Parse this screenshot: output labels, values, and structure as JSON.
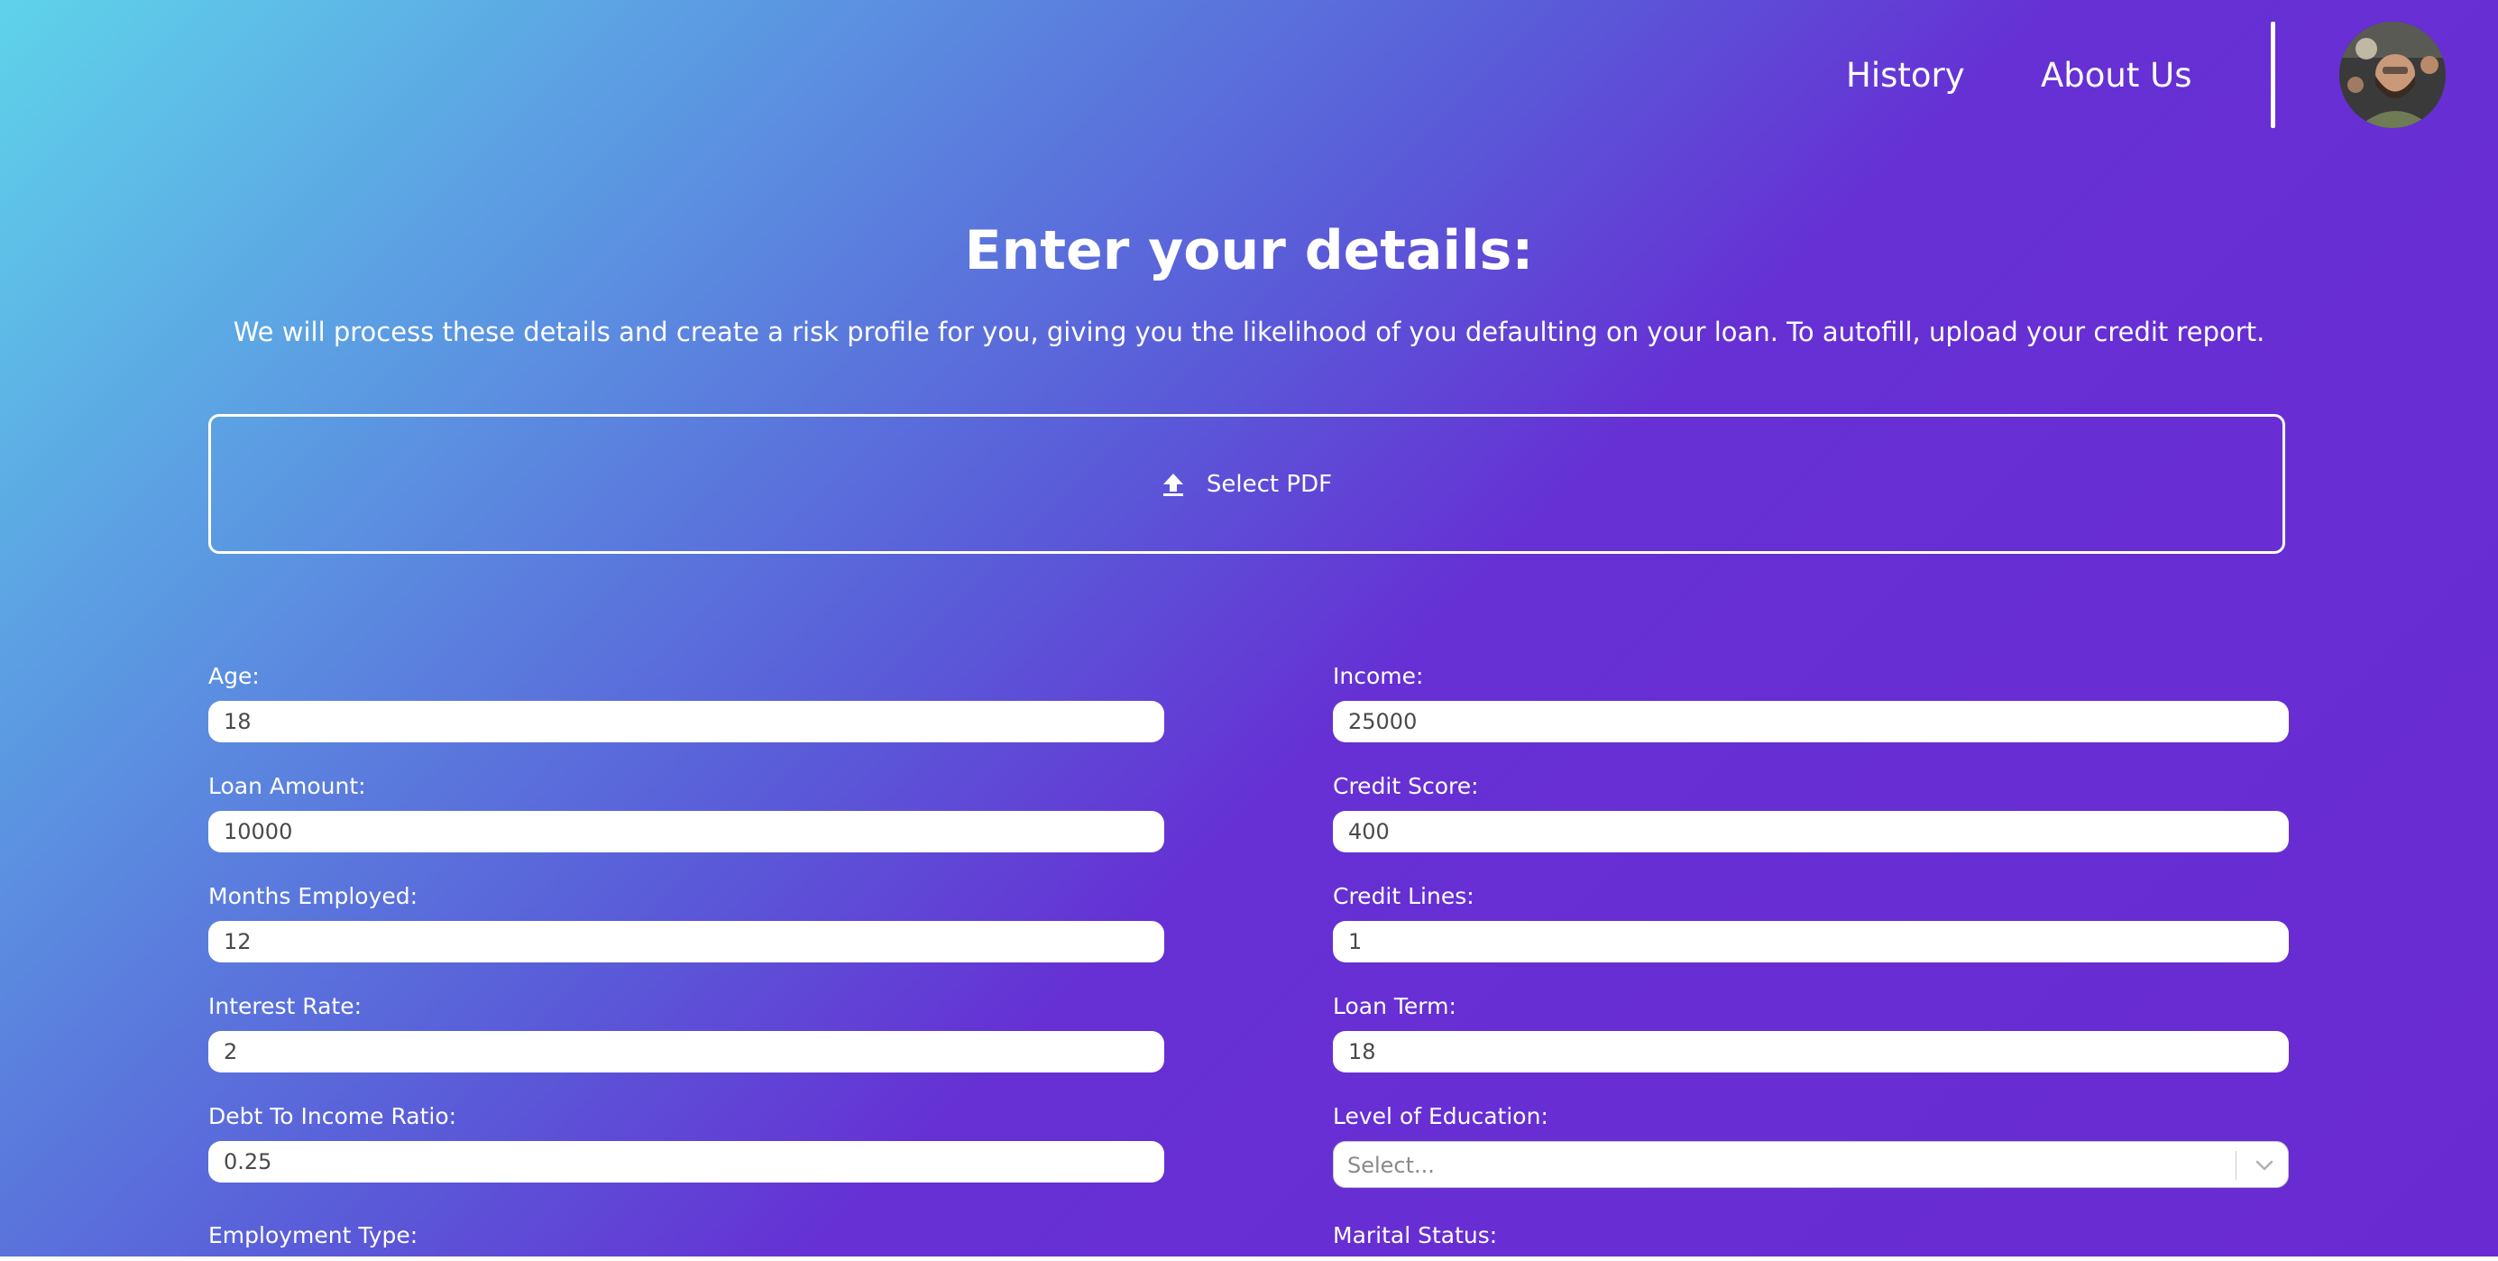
{
  "nav": {
    "links": [
      {
        "label": "History"
      },
      {
        "label": "About Us"
      }
    ]
  },
  "header": {
    "title": "Enter your details:",
    "subtitle": "We will process these details and create a risk profile for you, giving you the likelihood of you defaulting on your loan. To autofill, upload your credit report."
  },
  "upload": {
    "label": "Select PDF",
    "icon": "upload-icon"
  },
  "form": {
    "age": {
      "label": "Age:",
      "value": "18"
    },
    "income": {
      "label": "Income:",
      "value": "25000"
    },
    "loan_amount": {
      "label": "Loan Amount:",
      "value": "10000"
    },
    "credit_score": {
      "label": "Credit Score:",
      "value": "400"
    },
    "months_employed": {
      "label": "Months Employed:",
      "value": "12"
    },
    "credit_lines": {
      "label": "Credit Lines:",
      "value": "1"
    },
    "interest_rate": {
      "label": "Interest Rate:",
      "value": "2"
    },
    "loan_term": {
      "label": "Loan Term:",
      "value": "18"
    },
    "debt_to_income": {
      "label": "Debt To Income Ratio:",
      "value": "0.25"
    },
    "education": {
      "label": "Level of Education:",
      "placeholder": "Select..."
    },
    "employment_type": {
      "label": "Employment Type:"
    },
    "marital_status": {
      "label": "Marital Status:"
    }
  },
  "colors": {
    "gradient_start": "#5fd3ea",
    "gradient_mid": "#5a5ad8",
    "gradient_end": "#6a2ad2",
    "text": "#ffffff",
    "input_background": "#ffffff"
  }
}
